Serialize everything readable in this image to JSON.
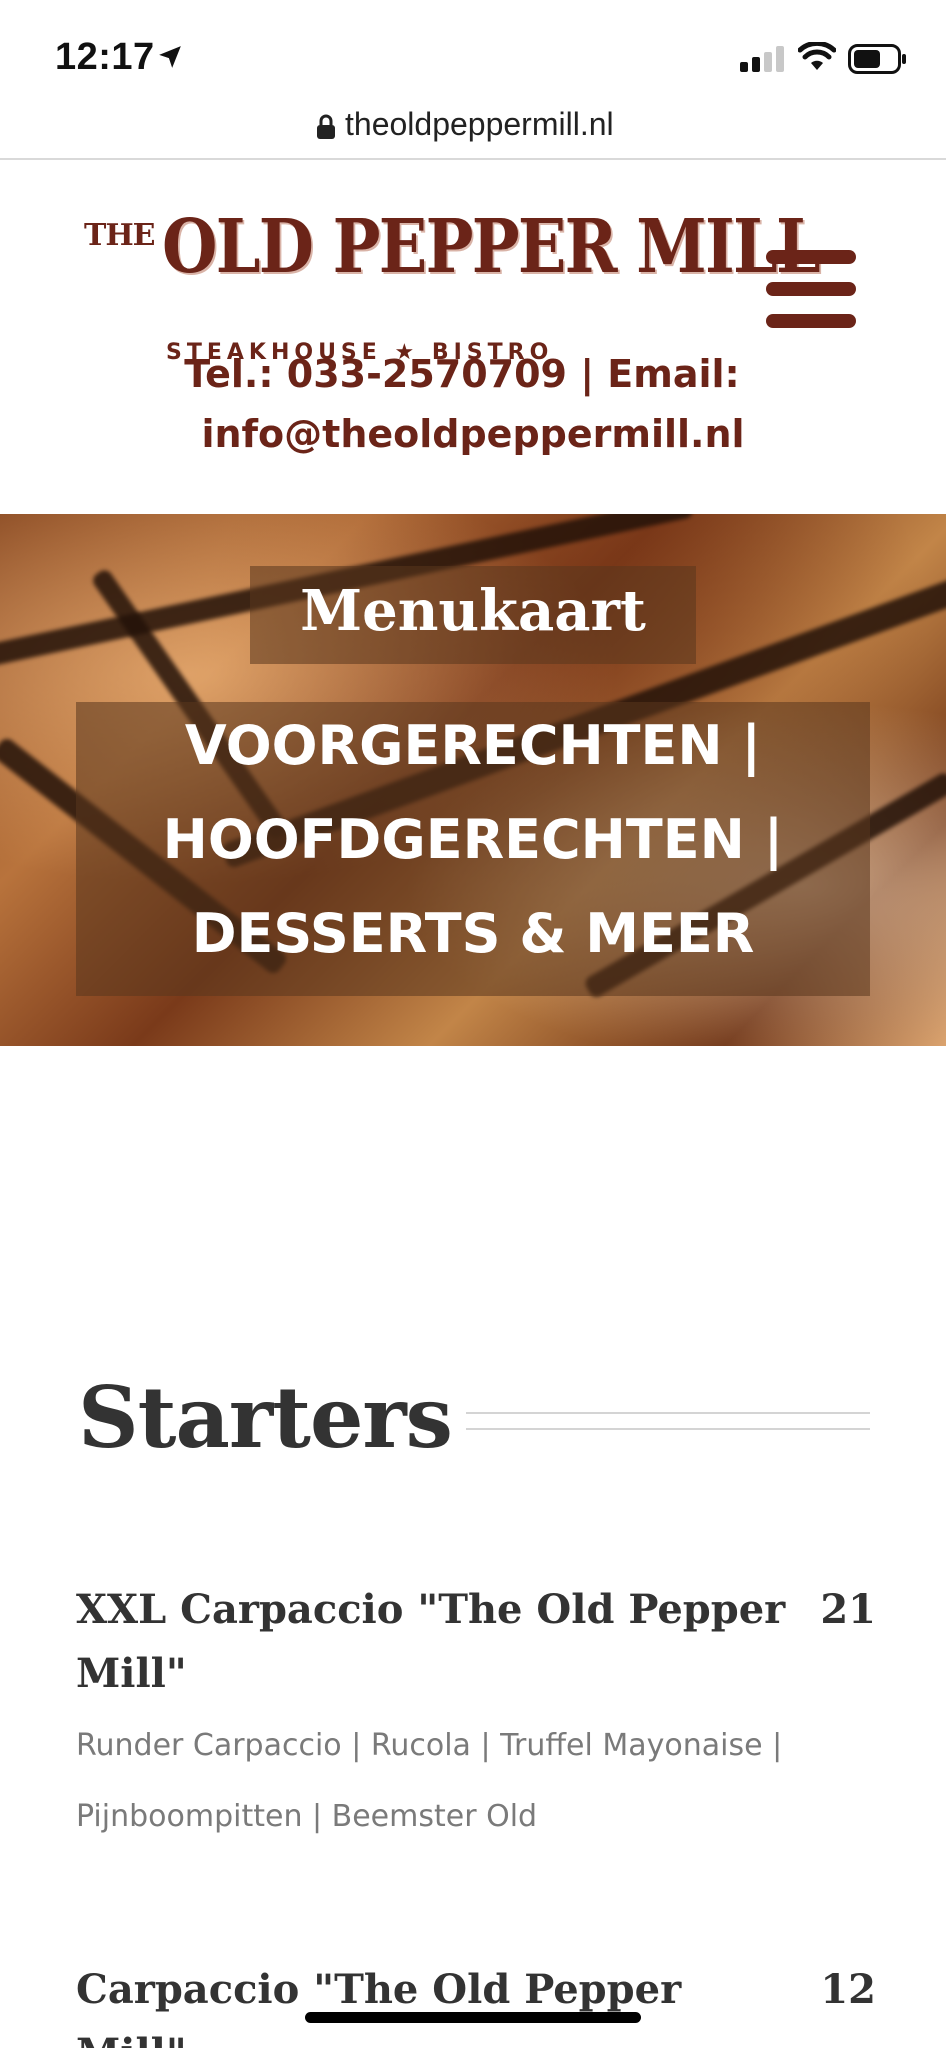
{
  "status_bar": {
    "time": "12:17"
  },
  "browser": {
    "url": "theoldpeppermill.nl"
  },
  "header": {
    "logo": {
      "the": "THE",
      "name": "OLD PEPPER MILL",
      "tagline": "STEAKHOUSE ★ BISTRO"
    },
    "contact_line1": "Tel.: 033-2570709 | Email:",
    "contact_line2": "info@theoldpeppermill.nl",
    "colors": {
      "brand": "#6b2418"
    }
  },
  "hero": {
    "title": "Menukaart",
    "subtitle_lines": [
      "VOORGERECHTEN |",
      "HOOFDGERECHTEN |",
      "DESSERTS & MEER"
    ]
  },
  "menu": {
    "section_title": "Starters",
    "items": [
      {
        "name_line1": "XXL Carpaccio \"The Old Pepper",
        "name_line2": "Mill\"",
        "price": "21",
        "desc_line1": "Runder Carpaccio | Rucola | Truffel Mayonaise |",
        "desc_line2": "Pijnboompitten | Beemster Old"
      },
      {
        "name_line1": "Carpaccio \"The Old Pepper Mill\"",
        "price": "12"
      }
    ]
  }
}
